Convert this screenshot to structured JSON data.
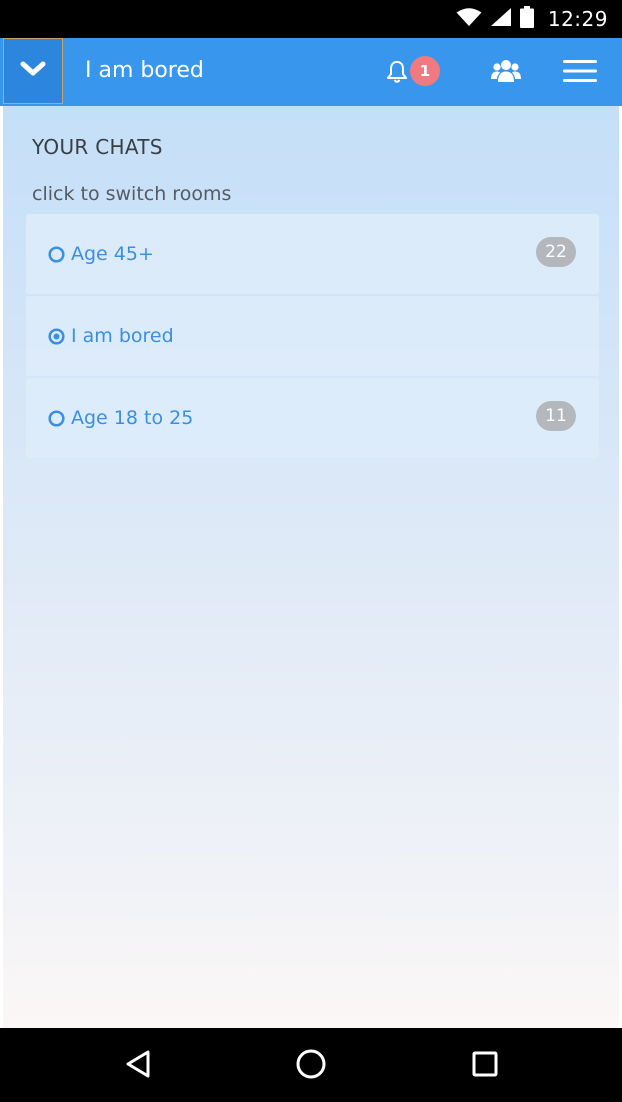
{
  "status_bar": {
    "time": "12:29",
    "icons": [
      "wifi-icon",
      "cell-signal-icon",
      "battery-icon"
    ]
  },
  "app_bar": {
    "title": "I am bored",
    "notification_count": "1",
    "icons": [
      "chevron-down-icon",
      "bell-icon",
      "users-icon",
      "hamburger-menu-icon"
    ],
    "colors": {
      "bar": "#3897ec",
      "badge": "#f07a7f"
    }
  },
  "chats": {
    "heading": "YOUR CHATS",
    "hint": "click to switch rooms",
    "items": [
      {
        "name": "Age 45+",
        "count": "22",
        "selected": false
      },
      {
        "name": "I am bored",
        "count": "",
        "selected": true
      },
      {
        "name": "Age 18 to 25",
        "count": "11",
        "selected": false
      }
    ],
    "colors": {
      "link": "#3a8fe0",
      "count_badge": "#b4b8bd"
    }
  },
  "nav_bar": {
    "icons": [
      "back-triangle-icon",
      "home-circle-icon",
      "recents-square-icon"
    ]
  }
}
